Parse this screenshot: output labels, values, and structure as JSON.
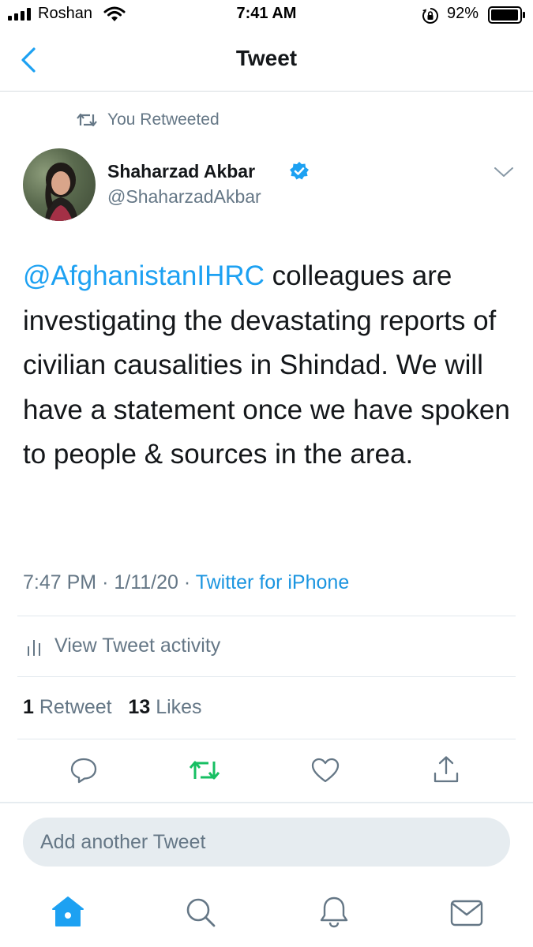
{
  "status_bar": {
    "carrier": "Roshan",
    "time": "7:41 AM",
    "battery_percent": "92%",
    "icons": [
      "signal-icon",
      "wifi-icon",
      "orientation-lock-icon",
      "battery-icon"
    ]
  },
  "nav": {
    "title": "Tweet",
    "back_icon": "chevron-left-icon"
  },
  "tweet": {
    "retweet_notice": "You Retweeted",
    "author": {
      "name": "Shaharzad Akbar",
      "handle": "@ShaharzadAkbar",
      "verified": true
    },
    "mention": "@AfghanistanIHRC",
    "text": " colleagues are investigating the devastating reports of civilian causalities in Shindad. We will have a statement once we have spoken to people & sources in the area.",
    "time": "7:47 PM",
    "date": "1/11/20",
    "separator": "·",
    "source": "Twitter for iPhone",
    "activity_label": "View Tweet activity",
    "retweet_count": "1",
    "retweet_label": "Retweet",
    "like_count": "13",
    "like_label": "Likes"
  },
  "actions": [
    "reply-icon",
    "retweet-icon",
    "like-icon",
    "share-icon"
  ],
  "composer": {
    "placeholder": "Add another Tweet"
  },
  "tab_bar": [
    "home-icon",
    "search-icon",
    "notifications-icon",
    "messages-icon"
  ],
  "colors": {
    "accent": "#1da1f2",
    "retweet_active": "#17bf63",
    "secondary_text": "#657786"
  }
}
